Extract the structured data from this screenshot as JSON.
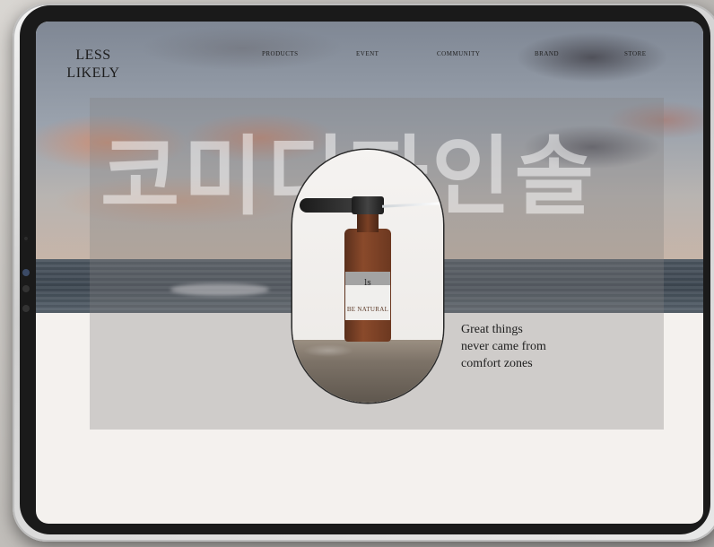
{
  "site": {
    "logo_line1": "LESS",
    "logo_line2": "LIKELY"
  },
  "nav": {
    "items": [
      {
        "label": "PRODUCTS"
      },
      {
        "label": "EVENT"
      },
      {
        "label": "COMMUNITY"
      },
      {
        "label": "BRAND"
      },
      {
        "label": "STORE"
      }
    ]
  },
  "hero": {
    "watermark": "코미디자인솔",
    "product_label": "BE NATURAL",
    "product_mark": "ls",
    "tagline": [
      "Great things",
      "never came from",
      "comfort zones"
    ]
  },
  "colors": {
    "background": "#f4f1ee",
    "text": "#1e1e1e",
    "bottle": "#8a4a2b"
  }
}
